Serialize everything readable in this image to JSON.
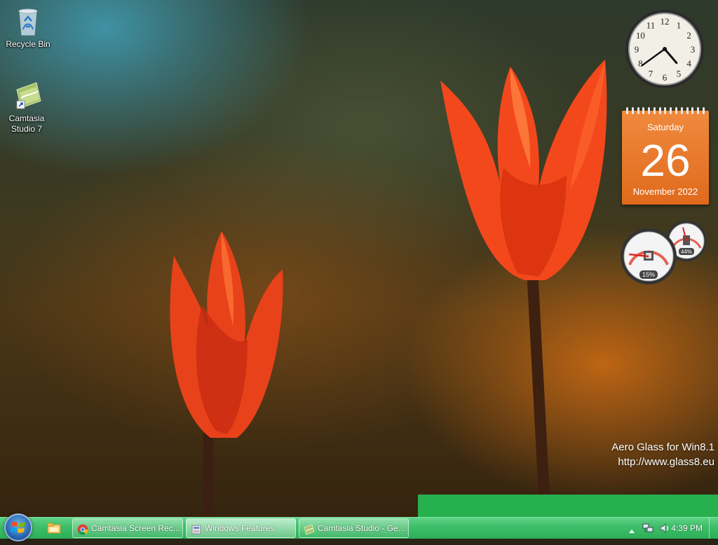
{
  "desktop": {
    "icons": [
      {
        "label": "Recycle Bin",
        "icon": "recycle-bin-icon"
      },
      {
        "label": "Camtasia Studio 7",
        "icon": "camtasia-icon"
      }
    ]
  },
  "gadgets": {
    "clock": {
      "hour": 4,
      "minute": 39,
      "numerals": [
        "12",
        "1",
        "2",
        "3",
        "4",
        "5",
        "6",
        "7",
        "8",
        "9",
        "10",
        "11"
      ]
    },
    "calendar": {
      "day_name": "Saturday",
      "day_number": "26",
      "month_year": "November 2022",
      "color": "#e8742a"
    },
    "cpu_meter": {
      "cpu_label": "15%",
      "cpu_value": 15,
      "memory_label": "44%",
      "memory_value": 44
    }
  },
  "watermark": {
    "line1": "Aero Glass for Win8.1",
    "line2": "http://www.glass8.eu"
  },
  "taskbar": {
    "start_button": "start-orb-icon",
    "pinned": [
      {
        "name": "windows-explorer-icon"
      }
    ],
    "tasks": [
      {
        "label": "Camtasia Screen Rec...",
        "icon": "chrome-icon"
      },
      {
        "label": "Windows Features",
        "icon": "windows-features-icon"
      },
      {
        "label": "Camtasia Studio - Ge...",
        "icon": "camtasia-icon"
      }
    ],
    "tray": {
      "time": "4:39 PM",
      "icons": [
        "show-hidden-icons-arrow",
        "network-icon",
        "volume-icon"
      ]
    },
    "color": "#3fbf6a"
  }
}
